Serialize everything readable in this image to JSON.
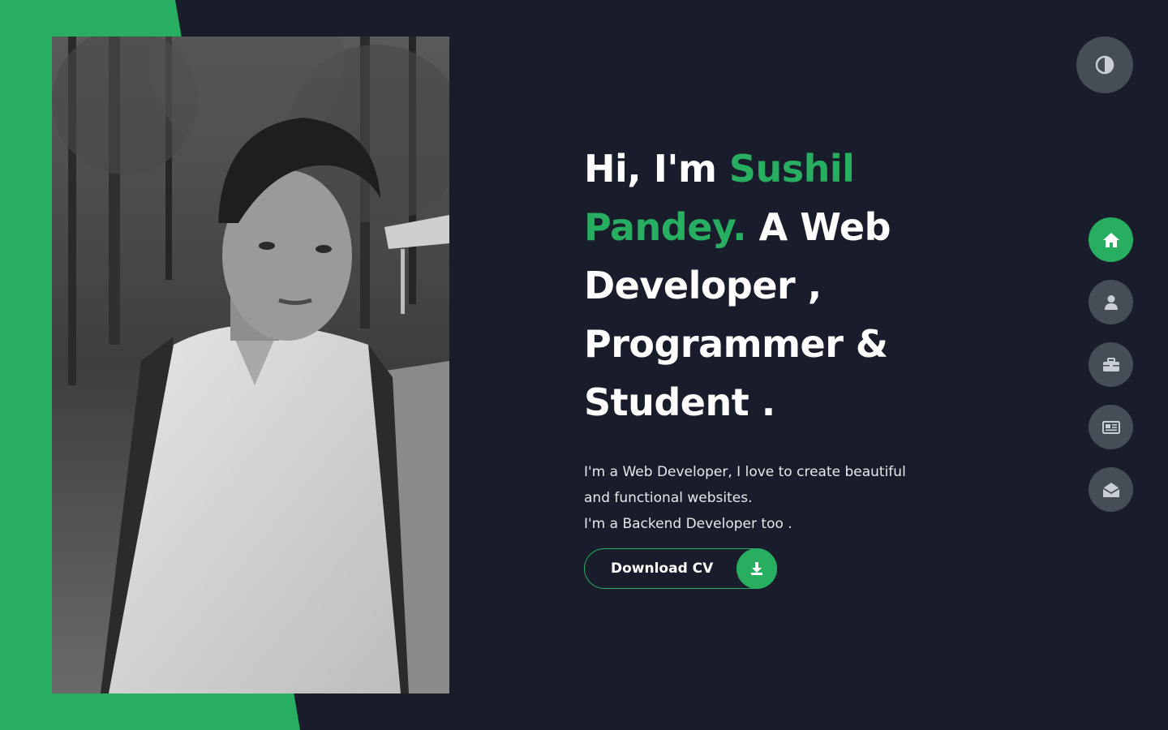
{
  "hero": {
    "greeting": "Hi, I'm ",
    "name": "Sushil Pandey.",
    "role_line": " A Web Developer , Programmer & Student .",
    "description_line1": "I'm a Web Developer, I love to create beautiful and functional websites.",
    "description_line2": "I'm a Backend Developer too ."
  },
  "cv_button": {
    "label": "Download CV",
    "icon": "download-icon"
  },
  "theme_toggle": {
    "icon": "contrast-icon"
  },
  "nav": {
    "items": [
      {
        "key": "home",
        "icon": "home-icon",
        "active": true
      },
      {
        "key": "about",
        "icon": "user-icon",
        "active": false
      },
      {
        "key": "portfolio",
        "icon": "briefcase-icon",
        "active": false
      },
      {
        "key": "blogs",
        "icon": "newspaper-icon",
        "active": false
      },
      {
        "key": "contact",
        "icon": "envelope-open-icon",
        "active": false
      }
    ]
  },
  "colors": {
    "background": "#191d2b",
    "accent": "#27ae60",
    "button_grey": "#454e56",
    "text": "#ffffff"
  }
}
